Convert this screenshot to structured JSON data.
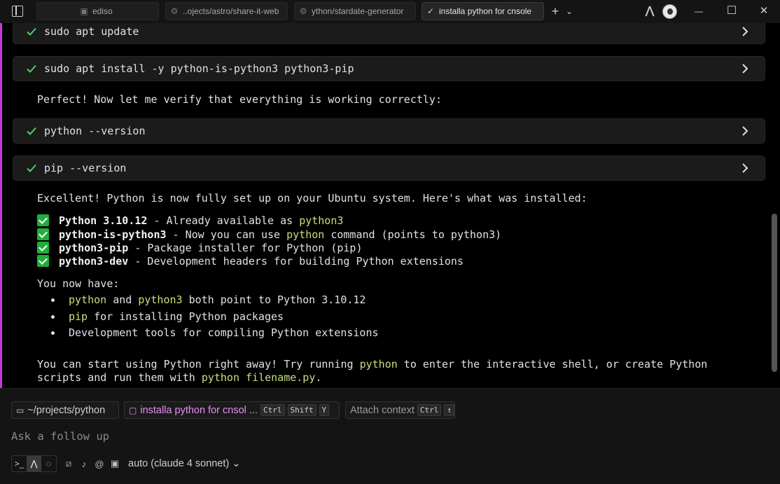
{
  "tabs": [
    {
      "label": "ediso",
      "icon": "folder-icon"
    },
    {
      "label": "..ojects/astro/share-it-web",
      "icon": "git-icon"
    },
    {
      "label": "ython/stardate-generator",
      "icon": "git-icon"
    },
    {
      "label": "installa python for cnsole",
      "icon": "check-icon",
      "active": true
    }
  ],
  "window": {
    "new_tab": "+",
    "dropdown": "⌄",
    "minimize": "—",
    "maximize": "☐",
    "close": "✕"
  },
  "commands": [
    {
      "text": "sudo apt update"
    },
    {
      "text": "sudo apt install -y python-is-python3 python3-pip"
    },
    {
      "text": "python --version"
    },
    {
      "text": "pip --version"
    }
  ],
  "messages": {
    "verify": "Perfect! Now let me verify that everything is working correctly:",
    "excellent": "Excellent! Python is now fully set up on your Ubuntu system. Here's what was installed:",
    "installed": [
      {
        "name": "Python 3.10.12",
        "sep": " - Already available as ",
        "code": "python3",
        "rest": ""
      },
      {
        "name": "python-is-python3",
        "sep": " - Now you can use ",
        "code": "python",
        "rest": " command (points to python3)"
      },
      {
        "name": "python3-pip",
        "sep": " - Package installer for Python (pip)",
        "code": "",
        "rest": ""
      },
      {
        "name": "python3-dev",
        "sep": " - Development headers for building Python extensions",
        "code": "",
        "rest": ""
      }
    ],
    "you_now_have": "You now have:",
    "bullets": {
      "b1_code1": "python",
      "b1_mid": " and ",
      "b1_code2": "python3",
      "b1_rest": " both point to Python 3.10.12",
      "b2_code": "pip",
      "b2_rest": " for installing Python packages",
      "b3": "Development tools for compiling Python extensions"
    },
    "final": {
      "p1": "You can start using Python right away! Try running ",
      "c1": "python",
      "p2": " to enter the interactive shell, or create Python",
      "p3": "scripts and run them with ",
      "c2": "python filename.py",
      "p4": "."
    }
  },
  "composer": {
    "directory": "~/projects/python",
    "conversation": "installa python for cnsol ...",
    "shortcut": [
      "Ctrl",
      "Shift",
      "Y"
    ],
    "attach_label": "Attach context",
    "attach_keys": [
      "Ctrl",
      "↑"
    ],
    "placeholder": "Ask a follow up",
    "model": "auto (claude 4 sonnet)"
  },
  "colors": {
    "accent_bar": "#c43bd8",
    "code_highlight": "#c5e07a",
    "check_green": "#1fae3a",
    "conversation_chip": "#e78ef0"
  }
}
